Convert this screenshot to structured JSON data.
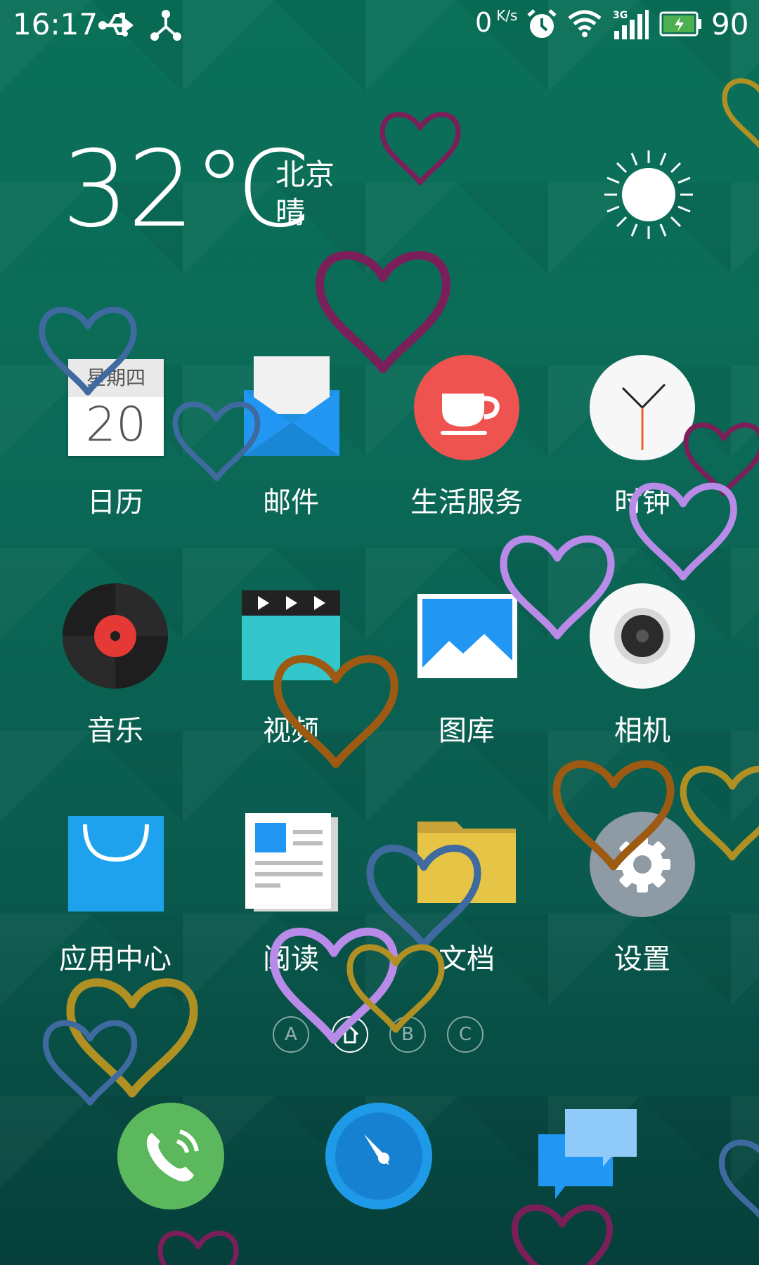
{
  "status_bar": {
    "time": "16:17",
    "net_speed_value": "0",
    "net_speed_unit": "K/s",
    "battery_percent": "90",
    "network_type": "3G",
    "icons": [
      "usb-icon",
      "share-icon",
      "alarm-icon",
      "wifi-icon",
      "signal-3g-icon",
      "battery-charging-icon"
    ]
  },
  "weather": {
    "temperature": "32℃",
    "city": "北京",
    "condition": "晴",
    "icon": "sun-icon"
  },
  "calendar_icon": {
    "weekday": "星期四",
    "day": "20"
  },
  "apps": [
    {
      "label": "日历",
      "icon": "calendar-icon"
    },
    {
      "label": "邮件",
      "icon": "mail-icon"
    },
    {
      "label": "生活服务",
      "icon": "coffee-cup-icon"
    },
    {
      "label": "时钟",
      "icon": "clock-icon"
    },
    {
      "label": "音乐",
      "icon": "vinyl-record-icon"
    },
    {
      "label": "视频",
      "icon": "clapperboard-icon"
    },
    {
      "label": "图库",
      "icon": "gallery-icon"
    },
    {
      "label": "相机",
      "icon": "camera-icon"
    },
    {
      "label": "应用中心",
      "icon": "shopping-bag-icon"
    },
    {
      "label": "阅读",
      "icon": "newspaper-icon"
    },
    {
      "label": "文档",
      "icon": "folder-icon"
    },
    {
      "label": "设置",
      "icon": "gear-icon"
    }
  ],
  "page_indicator": {
    "pages": [
      "A",
      "home",
      "B",
      "C"
    ],
    "active_index": 1
  },
  "dock": [
    {
      "icon": "phone-icon"
    },
    {
      "icon": "compass-browser-icon"
    },
    {
      "icon": "messages-icon"
    }
  ],
  "colors": {
    "background_top": "#0a7058",
    "background_bottom": "#063f3a",
    "mail_blue": "#1e90e0",
    "life_service_red": "#ef5350",
    "music_red": "#e53935",
    "video_cyan": "#33c7cc",
    "app_center_blue": "#1fa2ee",
    "folder_yellow": "#e6c445",
    "phone_green": "#5cb85c",
    "browser_blue": "#1581d0"
  }
}
